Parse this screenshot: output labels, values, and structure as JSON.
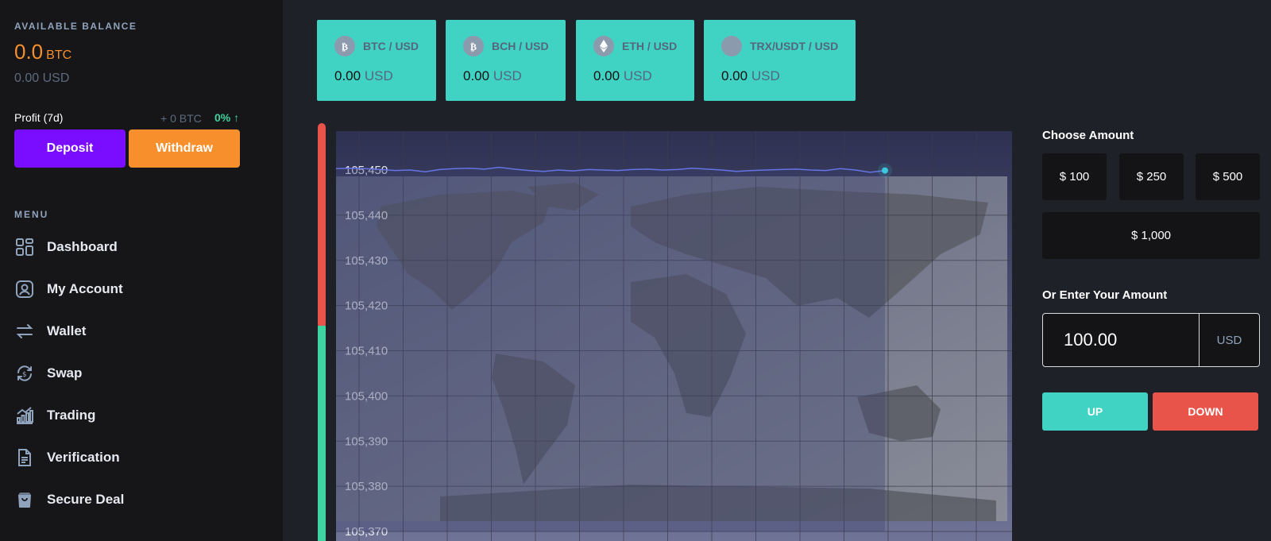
{
  "sidebar": {
    "balance_label": "AVAILABLE BALANCE",
    "balance_btc": "0.0",
    "balance_btc_unit": "BTC",
    "balance_usd": "0.00 USD",
    "profit_label": "Profit (7d)",
    "profit_btc": "+ 0 BTC",
    "profit_pct": "0% ↑",
    "deposit_label": "Deposit",
    "withdraw_label": "Withdraw",
    "menu_label": "MENU",
    "menu": [
      {
        "label": "Dashboard",
        "icon": "dashboard-icon"
      },
      {
        "label": "My Account",
        "icon": "user-icon"
      },
      {
        "label": "Wallet",
        "icon": "transfer-icon"
      },
      {
        "label": "Swap",
        "icon": "swap-icon"
      },
      {
        "label": "Trading",
        "icon": "bar-chart-icon"
      },
      {
        "label": "Verification",
        "icon": "document-icon"
      },
      {
        "label": "Secure Deal",
        "icon": "bag-icon"
      }
    ]
  },
  "tickers": [
    {
      "pair": "BTC / USD",
      "price": "0.00",
      "currency": "USD",
      "icon": "bitcoin-icon"
    },
    {
      "pair": "BCH / USD",
      "price": "0.00",
      "currency": "USD",
      "icon": "bitcoin-cash-icon"
    },
    {
      "pair": "ETH / USD",
      "price": "0.00",
      "currency": "USD",
      "icon": "ethereum-icon"
    },
    {
      "pair": "TRX/USDT / USD",
      "price": "0.00",
      "currency": "USD",
      "icon": "tron-icon"
    }
  ],
  "chart_data": {
    "type": "line",
    "y_ticks": [
      "105,450",
      "105,440",
      "105,430",
      "105,420",
      "105,410",
      "105,400",
      "105,390",
      "105,380",
      "105,370"
    ],
    "ylim": [
      105370,
      105450
    ],
    "series": [
      {
        "values": [
          105450.3,
          105450.4,
          105450.3,
          105450.1,
          105449.9,
          105450.0,
          105449.6,
          105450.1,
          105450.3,
          105450.4,
          105450.2,
          105450.6,
          105450.2,
          105449.9,
          105449.7,
          105450.0,
          105449.8,
          105450.1,
          105450.0,
          105449.9,
          105450.1,
          105450.2,
          105450.0,
          105450.1,
          105450.4,
          105450.2,
          105450.0,
          105449.7,
          105449.9,
          105450.0,
          105450.1,
          105450.2,
          105450.0,
          105449.9,
          105450.3,
          105450.0,
          105449.5,
          105449.9
        ]
      }
    ],
    "grid": true,
    "colors": {
      "line": "#6574e6",
      "bar_red": "#e8534a",
      "bar_green": "#3ed3a0"
    }
  },
  "panel": {
    "choose_label": "Choose Amount",
    "amounts": [
      "$ 100",
      "$ 250",
      "$ 500",
      "$ 1,000"
    ],
    "enter_label": "Or Enter Your Amount",
    "amount_value": "100.00",
    "amount_currency": "USD",
    "up_label": "UP",
    "down_label": "DOWN"
  }
}
